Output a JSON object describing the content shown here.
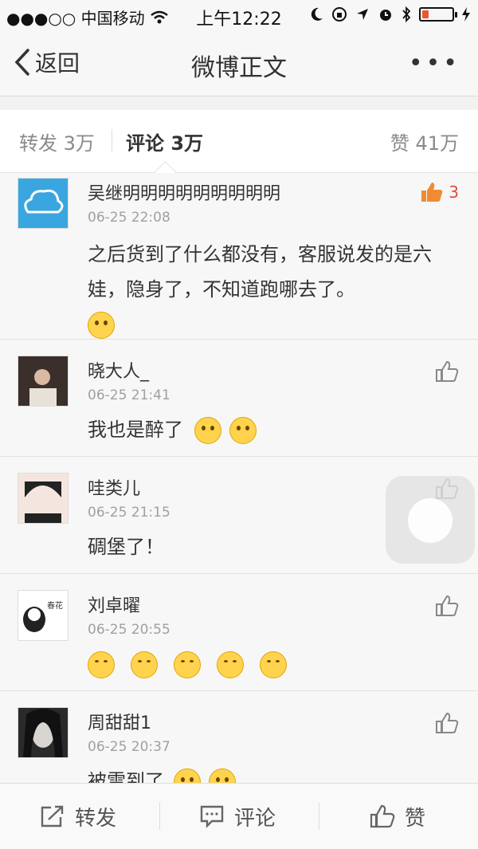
{
  "status_bar": {
    "carrier": "●●●○○ 中国移动",
    "time": "上午12:22"
  },
  "nav": {
    "back_label": "返回",
    "title": "微博正文",
    "more_label": "•••"
  },
  "tabs": {
    "repost": "转发 3万",
    "comment": "评论 3万",
    "like": "赞 41万"
  },
  "comments": [
    {
      "name": "吴继明明明明明明明明明",
      "time": "06-25 22:08",
      "text": "之后货到了什么都没有，客服说发的是六娃，隐身了，不知道跑哪去了。",
      "likes": "3",
      "liked": true
    },
    {
      "name": "晓大人_",
      "time": "06-25 21:41",
      "text": "我也是醉了",
      "likes": "",
      "liked": false
    },
    {
      "name": "哇类儿",
      "time": "06-25 21:15",
      "text": "碉堡了！",
      "likes": "",
      "liked": false
    },
    {
      "name": "刘卓曜",
      "time": "06-25 20:55",
      "text": "",
      "likes": "",
      "liked": false
    },
    {
      "name": "周甜甜1",
      "time": "06-25 20:37",
      "text": "被雷到了",
      "likes": "",
      "liked": false
    }
  ],
  "toolbar": {
    "repost": "转发",
    "comment": "评论",
    "like": "赞"
  },
  "colors": {
    "accent_like": "#e24b3b",
    "background": "#f7f7f7"
  }
}
